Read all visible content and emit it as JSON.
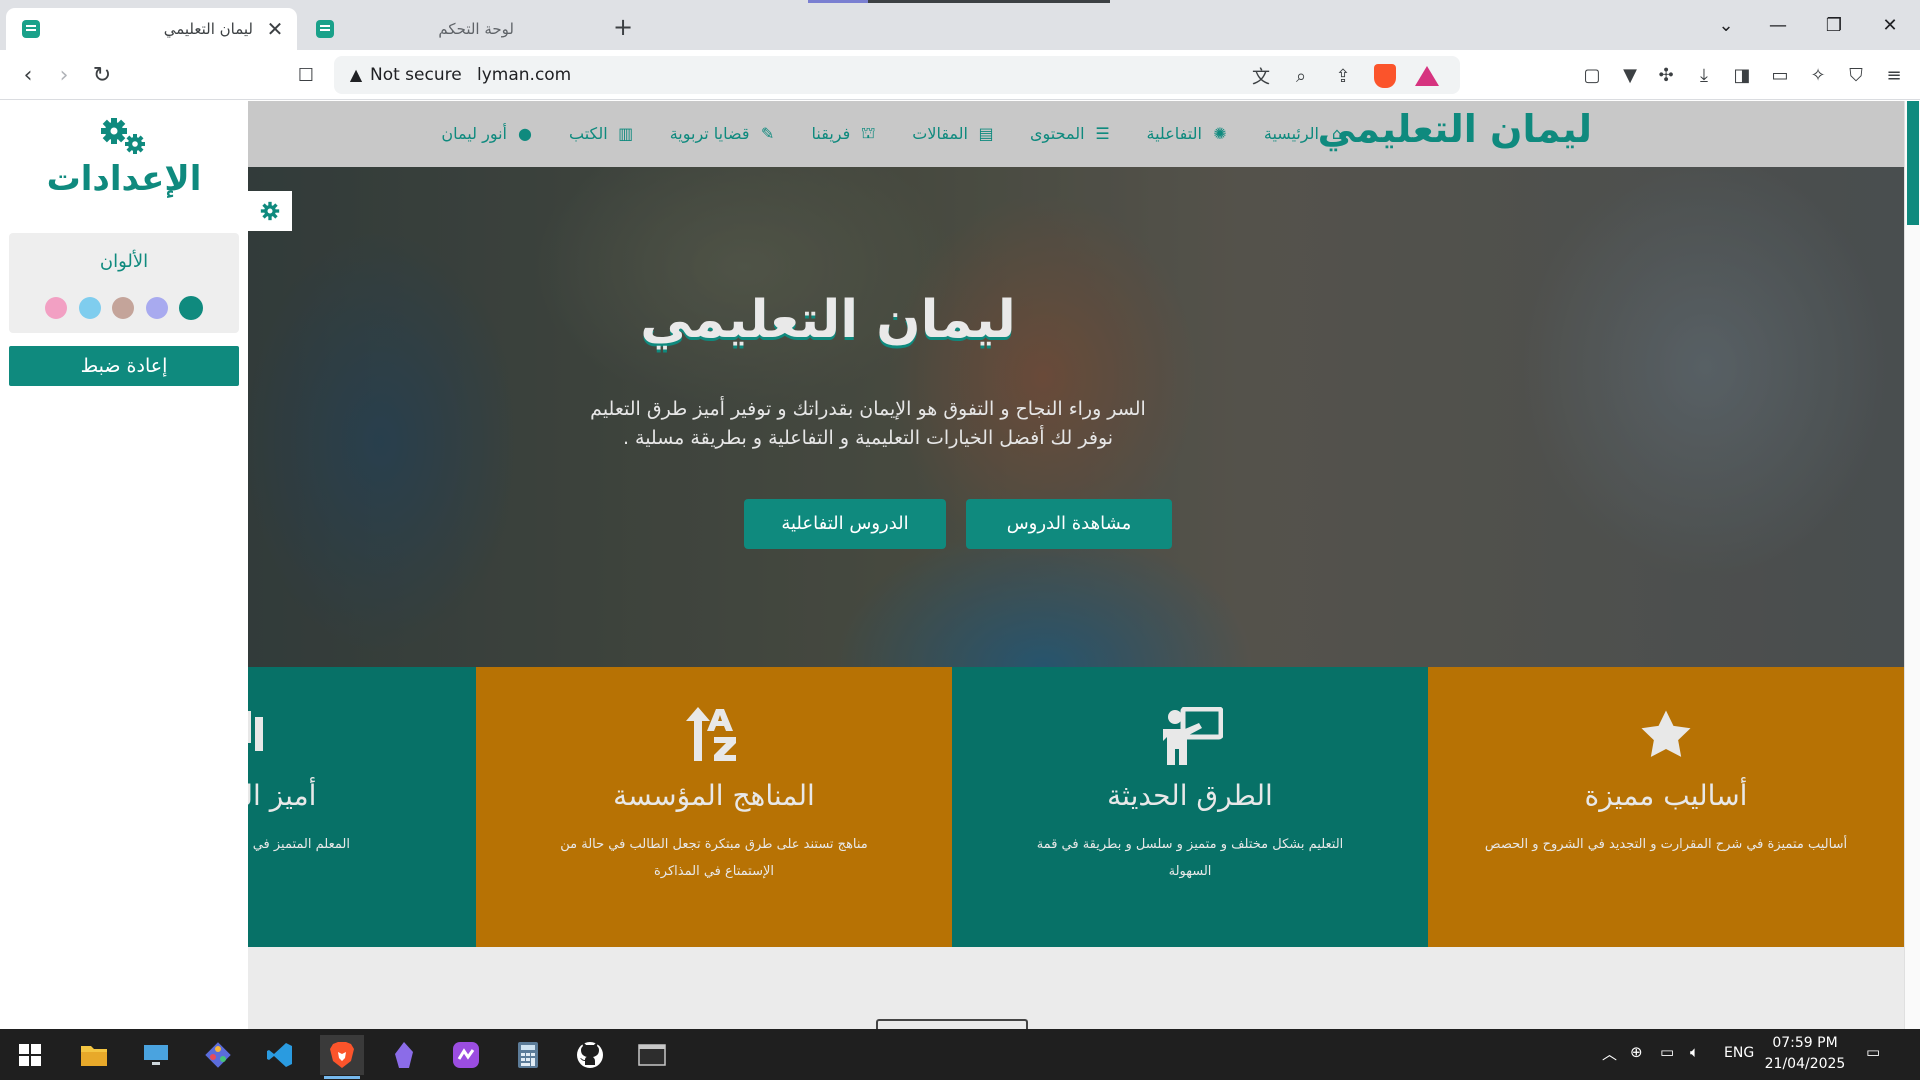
{
  "browser": {
    "tabs": [
      {
        "title": "ليمان التعليمي",
        "active": true
      },
      {
        "title": "لوحة التحكم",
        "active": false
      }
    ],
    "new_tab": "+",
    "security_label": "Not secure",
    "url": "lyman.com"
  },
  "settings": {
    "title": "الإعدادات",
    "colors_label": "الألوان",
    "swatches": [
      "#f2a0c3",
      "#7fcdee",
      "#c4a49a",
      "#a8aaef",
      "#0f8a7e"
    ],
    "reset_label": "إعادة ضبط"
  },
  "site": {
    "logo": "ليمان التعليمي",
    "nav": [
      {
        "label": "الرئيسية",
        "icon": "home-icon"
      },
      {
        "label": "التفاعلية",
        "icon": "badge-icon"
      },
      {
        "label": "المحتوى",
        "icon": "list-icon"
      },
      {
        "label": "المقالات",
        "icon": "newspaper-icon"
      },
      {
        "label": "فريقنا",
        "icon": "school-icon"
      },
      {
        "label": "قضايا تربوية",
        "icon": "pen-icon"
      },
      {
        "label": "الكتب",
        "icon": "book-icon"
      },
      {
        "label": "أنور ليمان",
        "icon": "user-circle-icon"
      }
    ]
  },
  "hero": {
    "title": "ليمان التعليمي",
    "line1": "السر وراء النجاح و التفوق هو الإيمان بقدراتك و توفير أميز طرق التعليم",
    "line2": "نوفر لك أفضل الخيارات التعليمية و التفاعلية و بطريقة مسلية .",
    "btn_watch": "مشاهدة الدروس",
    "btn_interactive": "الدروس التفاعلية"
  },
  "features": [
    {
      "title": "أساليب مميزة",
      "text": "أساليب متميزة في شرح المقرارت و التجديد في الشروح و الحصص",
      "icon": "star-icon"
    },
    {
      "title": "الطرق الحديثة",
      "text": "التعليم بشكل مختلف و متميز و سلسل و بطريقة في قمة السهولة",
      "icon": "teacher-board-icon"
    },
    {
      "title": "المناهج المؤسسة",
      "text": "مناهج تستند على طرق مبتكرة تجعل الطالب في حالة من الإستمتاع في المذاكرة",
      "icon": "sort-alpha-icon"
    },
    {
      "title": "أميز المعلمين",
      "text": "المعلم المتميز في طريقة شرحه عن غيره",
      "icon": "chalkboard-icon"
    }
  ],
  "taskbar": {
    "lang": "ENG",
    "time": "07:59 PM",
    "date": "21/04/2025"
  },
  "colors": {
    "accent": "#0f8a7e",
    "feature_teal": "#077167",
    "feature_orange": "#b77204"
  }
}
